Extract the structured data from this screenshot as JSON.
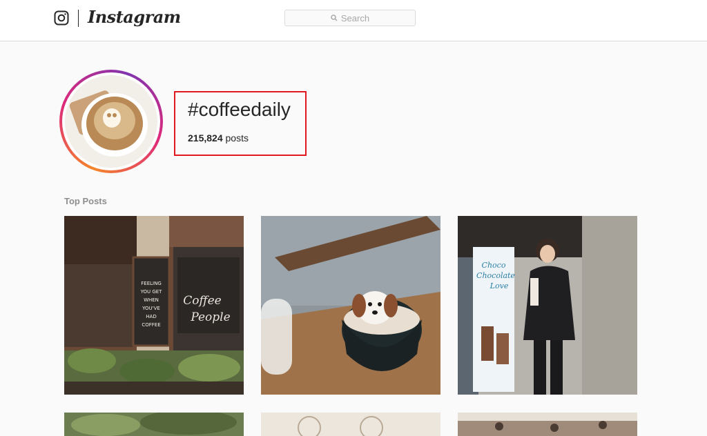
{
  "topbar": {
    "brand": "Instagram",
    "logo_icon": "instagram-camera-icon",
    "search_placeholder": "Search",
    "search_icon": "search-icon"
  },
  "tag": {
    "name": "#coffeedaily",
    "post_count": "215,824",
    "posts_label": "posts"
  },
  "sections": {
    "top_posts": "Top Posts"
  },
  "posts": [
    {
      "description": "cafe-storefront"
    },
    {
      "description": "dog-latte-cup"
    },
    {
      "description": "woman-with-coffee"
    }
  ],
  "poster_text": {
    "sign": "Coffee People",
    "chalkboard": [
      "FEELING",
      "YOU GET",
      "WHEN",
      "YOU'VE",
      "HAD",
      "COFFEE"
    ],
    "banner": "Choco Chocolate Love"
  },
  "colors": {
    "highlight": "#e0171f",
    "ring_start": "#f58529",
    "ring_end": "#dd2a7b"
  }
}
